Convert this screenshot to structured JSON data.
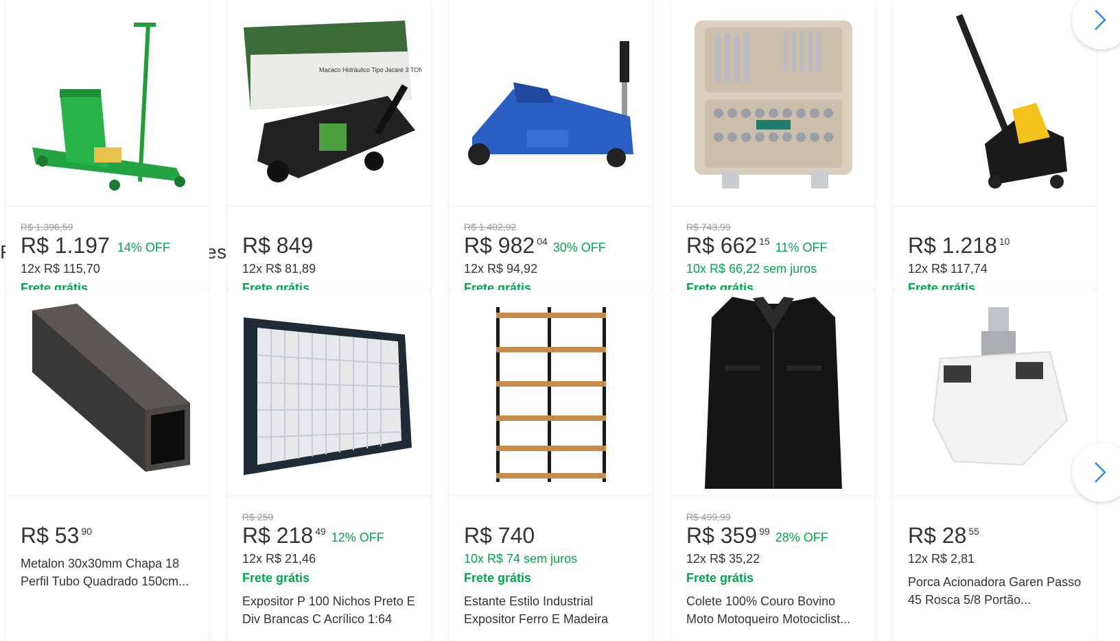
{
  "section_title_fragments": [
    "F",
    "es"
  ],
  "row1": [
    {
      "old_price": "R$ 1.396,59",
      "price": "R$ 1.197",
      "cents": "",
      "off": "14% OFF",
      "installments": "12x R$ 115,70",
      "installments_green": false,
      "shipping": "Frete grátis",
      "image": "green-floor-jack-image"
    },
    {
      "old_price": "",
      "price": "R$ 849",
      "cents": "",
      "off": "",
      "installments": "12x R$ 81,89",
      "installments_green": false,
      "shipping": "Frete grátis",
      "image": "boxed-hydraulic-jack-image",
      "box_text": "Macaco Hidráulico Tipo Jacaré 3 TON."
    },
    {
      "old_price": "R$ 1.402,92",
      "price": "R$ 982",
      "cents": "04",
      "off": "30% OFF",
      "installments": "12x R$ 94,92",
      "installments_green": false,
      "shipping": "Frete grátis",
      "image": "blue-floor-jack-image"
    },
    {
      "old_price": "R$ 743,99",
      "price": "R$ 662",
      "cents": "15",
      "off": "11% OFF",
      "installments": "10x R$ 66,22 sem juros",
      "installments_green": true,
      "shipping": "Frete grátis",
      "image": "socket-tool-set-image"
    },
    {
      "old_price": "",
      "price": "R$ 1.218",
      "cents": "10",
      "off": "",
      "installments": "12x R$ 117,74",
      "installments_green": false,
      "shipping": "Frete grátis",
      "image": "yellow-floor-jack-image"
    }
  ],
  "row2": [
    {
      "old_price": "",
      "price": "R$ 53",
      "cents": "90",
      "off": "",
      "installments": "",
      "installments_green": false,
      "shipping": "",
      "title": "Metalon 30x30mm Chapa 18 Perfil Tubo Quadrado 150cm...",
      "image": "square-steel-tube-image"
    },
    {
      "old_price": "R$ 250",
      "price": "R$ 218",
      "cents": "49",
      "off": "12% OFF",
      "installments": "12x R$ 21,46",
      "installments_green": false,
      "shipping": "Frete grátis",
      "title": "Expositor P 100 Nichos Preto E Div Brancas C Acrílico 1:64",
      "image": "display-case-image"
    },
    {
      "old_price": "",
      "price": "R$ 740",
      "cents": "",
      "off": "",
      "installments": "10x R$ 74 sem juros",
      "installments_green": true,
      "shipping": "Frete grátis",
      "title": "Estante Estilo Industrial Expositor Ferro E Madeira",
      "image": "industrial-shelf-image"
    },
    {
      "old_price": "R$ 499,99",
      "price": "R$ 359",
      "cents": "99",
      "off": "28% OFF",
      "installments": "12x R$ 35,22",
      "installments_green": false,
      "shipping": "Frete grátis",
      "title": "Colete 100% Couro Bovino Moto Motoqueiro Motociclist...",
      "image": "leather-vest-image"
    },
    {
      "old_price": "",
      "price": "R$ 28",
      "cents": "55",
      "off": "",
      "installments": "12x R$ 2,81",
      "installments_green": false,
      "shipping": "",
      "title": "Porca Acionadora Garen Passo 45 Rosca 5/8 Portão...",
      "image": "gate-actuator-nut-image"
    }
  ],
  "nav": {
    "next_icon": "chevron-right-icon"
  },
  "colors": {
    "green": "#00a650",
    "accent_blue": "#3483fa"
  }
}
